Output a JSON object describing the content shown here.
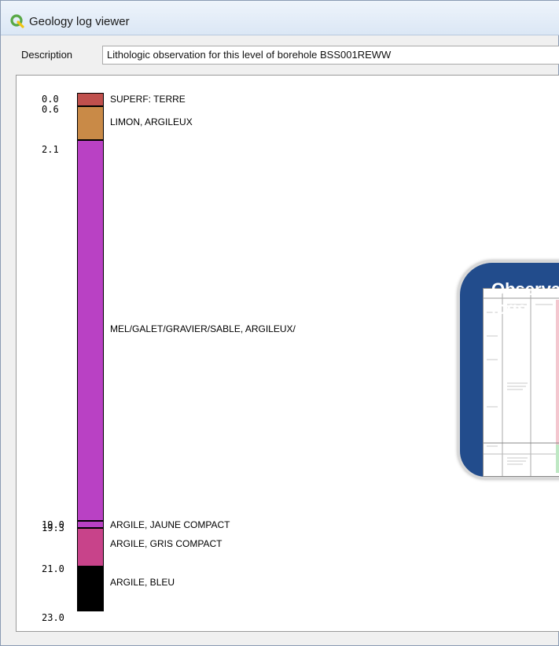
{
  "window": {
    "title": "Geology log viewer",
    "app_icon": "qgis-icon"
  },
  "description": {
    "label": "Description",
    "value": "Lithologic observation for this level of borehole BSS001REWW"
  },
  "log": {
    "depth_labels": [
      "0.0",
      "0.6",
      "2.1",
      "19.0",
      "19.3",
      "21.0",
      "23.0"
    ],
    "layers": [
      {
        "top": 0.0,
        "bottom": 0.6,
        "color": "#c0504d",
        "label": "SUPERF: TERRE"
      },
      {
        "top": 0.6,
        "bottom": 2.1,
        "color": "#c98a47",
        "label": "LIMON, ARGILEUX"
      },
      {
        "top": 2.1,
        "bottom": 19.0,
        "color": "#b941c4",
        "label": "MEL/GALET/GRAVIER/SABLE, ARGILEUX/"
      },
      {
        "top": 19.0,
        "bottom": 19.3,
        "color": "#b941c4",
        "label": "ARGILE, JAUNE COMPACT"
      },
      {
        "top": 19.3,
        "bottom": 21.0,
        "color": "#c8438a",
        "label": "ARGILE, GRIS COMPACT"
      },
      {
        "top": 21.0,
        "bottom": 23.0,
        "color": "#000000",
        "label": "ARGILE, BLEU"
      }
    ]
  },
  "overlay": {
    "title": "Observation logs"
  }
}
